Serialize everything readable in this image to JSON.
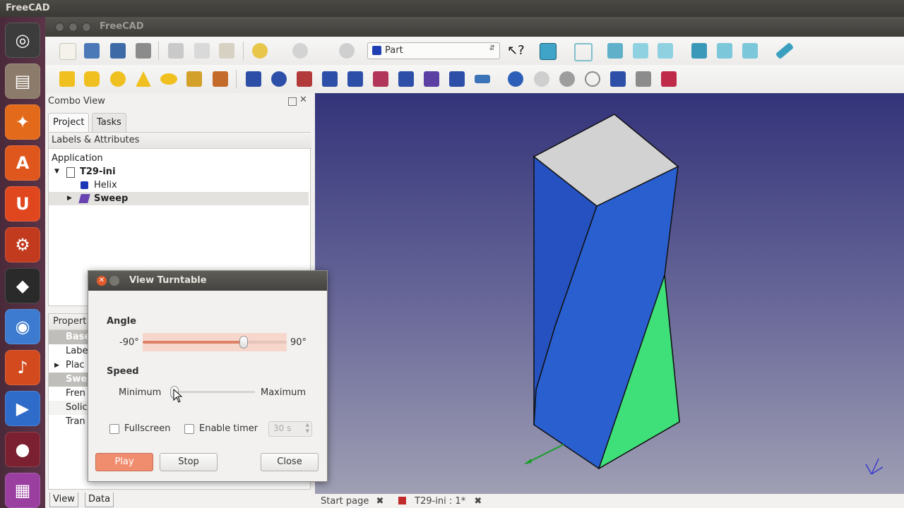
{
  "top_panel": {
    "title": "FreeCAD"
  },
  "window": {
    "title": "FreeCAD"
  },
  "workbench": {
    "selected": "Part"
  },
  "combo_view": {
    "title": "Combo View",
    "tabs": [
      "Project",
      "Tasks"
    ],
    "tree_header": "Labels & Attributes",
    "tree": [
      {
        "label": "Application",
        "level": 0
      },
      {
        "label": "T29-ini",
        "level": 1,
        "expanded": true
      },
      {
        "label": "Helix",
        "level": 2
      },
      {
        "label": "Sweep",
        "level": 2,
        "selected": true
      }
    ],
    "property_header": "Propert",
    "properties": [
      "Base",
      "Labe",
      "Plac",
      "Swe",
      "Fren",
      "Solic",
      "Tran"
    ],
    "bottom_tabs": [
      "View",
      "Data"
    ]
  },
  "document_tabs": [
    {
      "label": "Start page"
    },
    {
      "label": "T29-ini : 1*"
    }
  ],
  "dialog": {
    "title": "View Turntable",
    "angle_label": "Angle",
    "angle_min": "-90°",
    "angle_max": "90°",
    "angle_fraction": 0.7,
    "speed_label": "Speed",
    "speed_min": "Minimum",
    "speed_max": "Maximum",
    "speed_fraction": 0.05,
    "fullscreen_label": "Fullscreen",
    "enable_timer_label": "Enable timer",
    "timer_value": "30 s",
    "play": "Play",
    "stop": "Stop",
    "close": "Close"
  },
  "colors": {
    "accent": "#f08d6f",
    "face_red": "#c01f1f",
    "face_blue": "#2a5fd0",
    "face_green": "#3fe07a",
    "face_top": "#d2d2d2"
  }
}
